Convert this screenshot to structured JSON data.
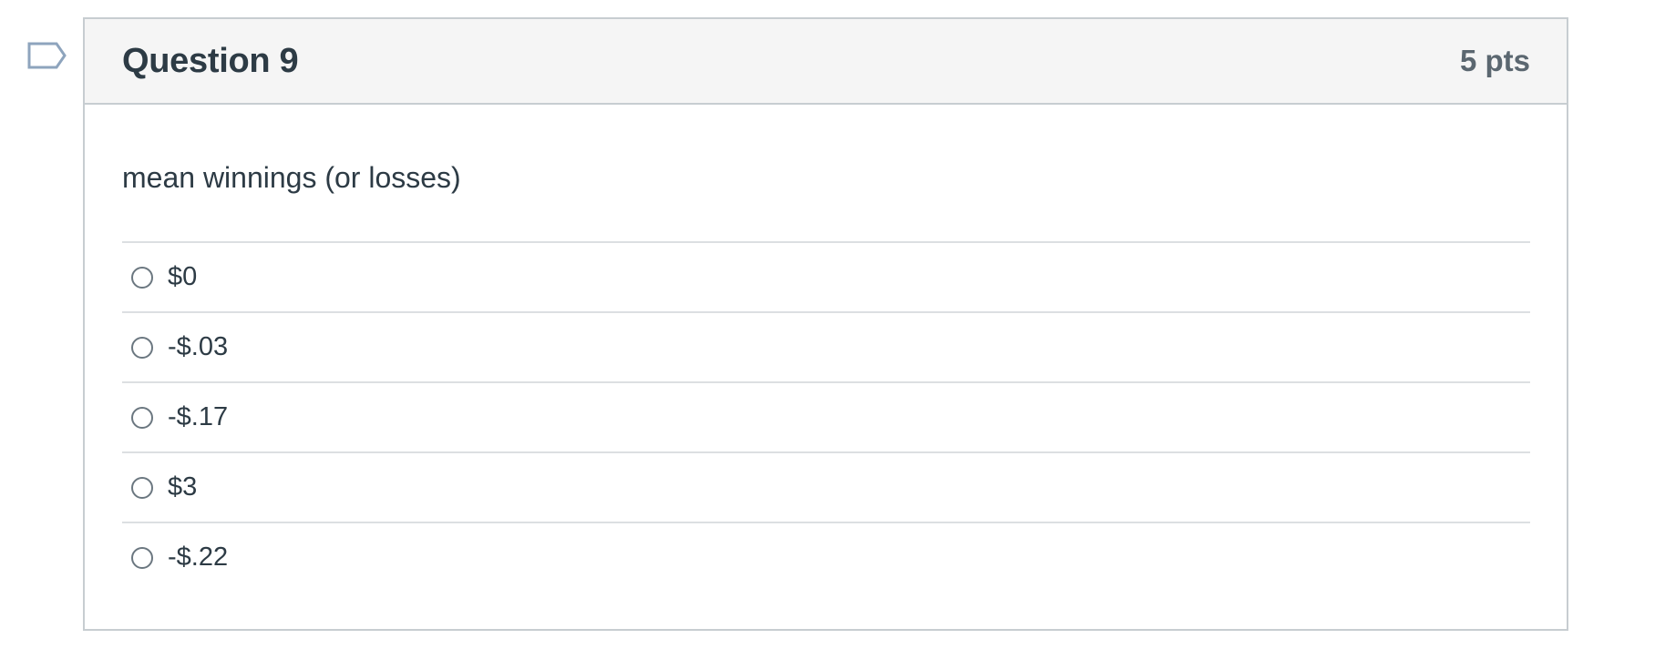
{
  "question": {
    "title": "Question 9",
    "points": "5 pts",
    "text": "mean winnings (or losses)",
    "flag_icon": "flag-icon",
    "answers": [
      {
        "label": "$0"
      },
      {
        "label": "-$.03"
      },
      {
        "label": "-$.17"
      },
      {
        "label": "$3"
      },
      {
        "label": "-$.22"
      }
    ]
  },
  "colors": {
    "header_bg": "#f5f5f5",
    "border": "#c7cdd1",
    "text": "#2d3b45",
    "points_text": "#5b6770",
    "flag_stroke": "#8ea4bd"
  }
}
